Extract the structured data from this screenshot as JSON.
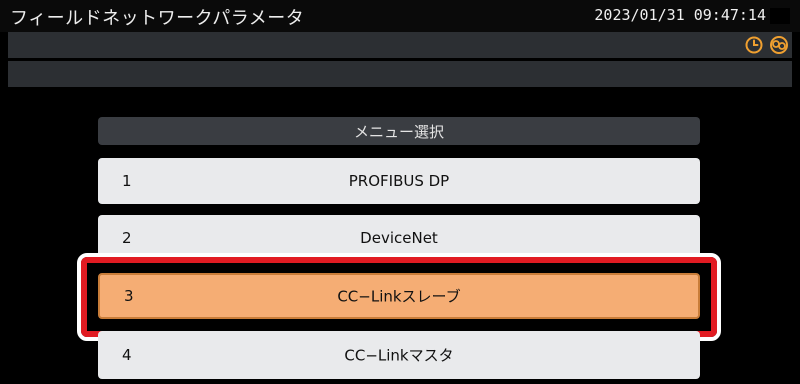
{
  "header": {
    "title": "フィールドネットワークパラメータ",
    "datetime": "2023/01/31 09:47:14"
  },
  "status_icons": [
    "clock-icon",
    "network-icon"
  ],
  "menu": {
    "header": "メニュー選択",
    "items": [
      {
        "num": "1",
        "label": "PROFIBUS DP",
        "selected": false
      },
      {
        "num": "2",
        "label": "DeviceNet",
        "selected": false
      },
      {
        "num": "3",
        "label": "CC−Linkスレーブ",
        "selected": true
      },
      {
        "num": "4",
        "label": "CC−Linkマスタ",
        "selected": false
      }
    ]
  },
  "colors": {
    "background": "#000000",
    "bar": "#2c2f33",
    "item": "#e9eaec",
    "selected": "#f5ad74",
    "highlight_red": "#e11b22",
    "icon_orange": "#f0a030"
  }
}
